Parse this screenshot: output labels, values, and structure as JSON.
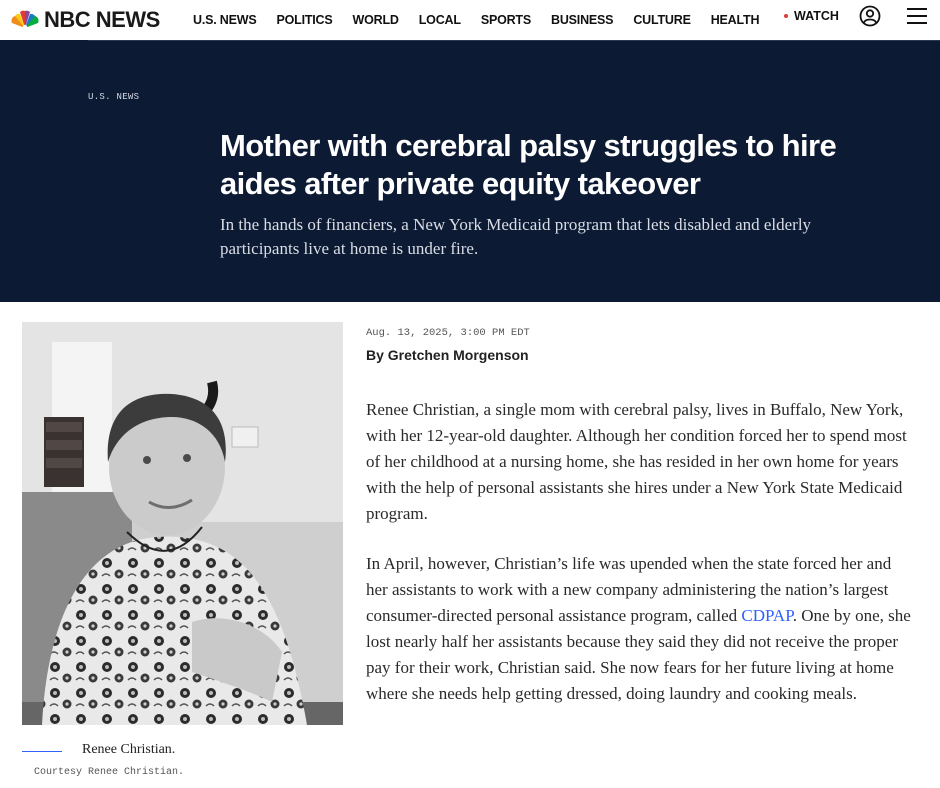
{
  "header": {
    "logo_text": "NBC NEWS",
    "nav": [
      "U.S. NEWS",
      "POLITICS",
      "WORLD",
      "LOCAL",
      "SPORTS",
      "BUSINESS",
      "CULTURE",
      "HEALTH"
    ],
    "watch_label": "WATCH"
  },
  "article": {
    "section": "U.S. NEWS",
    "headline": "Mother with cerebral palsy struggles to hire aides after private equity takeover",
    "dek": "In the hands of financiers, a New York Medicaid program that lets disabled and elderly participants live at home is under fire.",
    "timestamp": "Aug. 13, 2025, 3:00 PM EDT",
    "byline": "By Gretchen Morgenson",
    "photo": {
      "caption": "Renee Christian.",
      "credit": "Courtesy Renee Christian."
    },
    "paragraph1": "Renee Christian, a single mom with cerebral palsy, lives in Buffalo, New York, with her 12-year-old daughter. Although her condition forced her to spend most of her childhood at a nursing home, she has resided in her own home for years with the help of personal assistants she hires under a New York State Medicaid program.",
    "paragraph2_before": "In April, however, Christian’s life was upended when the state forced her and her assistants to work with a new company administering the nation’s largest consumer-directed personal assistance program, called ",
    "paragraph2_link": "CDPAP",
    "paragraph2_after": ". One by one, she lost nearly half her assistants because they said they did not receive the proper pay for their work, Christian said. She now fears for her future living at home where she needs help getting dressed, doing laundry and cooking meals."
  },
  "colors": {
    "hero_bg": "#0c1a33",
    "link": "#3061ff",
    "watch_dot": "#e03c31"
  },
  "icons": [
    "nbc-peacock-icon",
    "account-icon",
    "hamburger-menu-icon"
  ]
}
